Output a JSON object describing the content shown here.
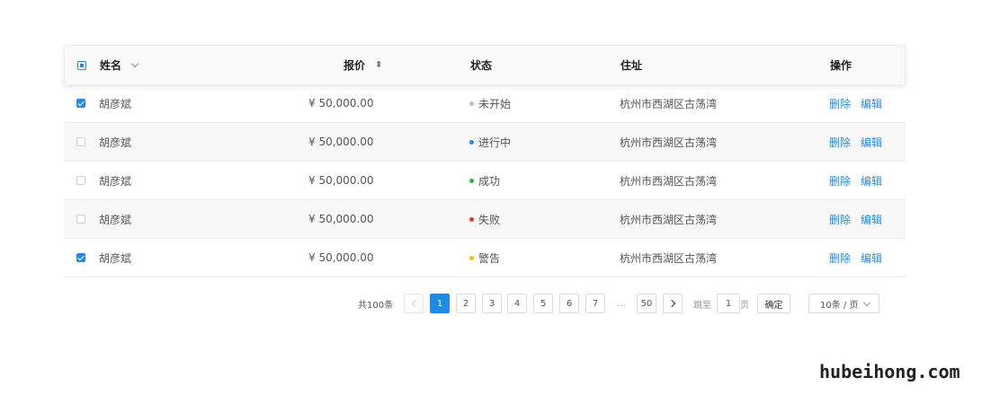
{
  "table": {
    "headers": {
      "name": "姓名",
      "price": "报价",
      "status": "状态",
      "address": "住址",
      "ops": "操作"
    },
    "rows": [
      {
        "checked": true,
        "name": "胡彦斌",
        "price": "¥ 50,000.00",
        "status": "未开始",
        "status_color": "#bfbfbf",
        "address": "杭州市西湖区古荡湾",
        "delete": "删除",
        "edit": "编辑"
      },
      {
        "checked": false,
        "name": "胡彦斌",
        "price": "¥ 50,000.00",
        "status": "进行中",
        "status_color": "#1f8ae8",
        "address": "杭州市西湖区古荡湾",
        "delete": "删除",
        "edit": "编辑"
      },
      {
        "checked": false,
        "name": "胡彦斌",
        "price": "¥ 50,000.00",
        "status": "成功",
        "status_color": "#19be3b",
        "address": "杭州市西湖区古荡湾",
        "delete": "删除",
        "edit": "编辑"
      },
      {
        "checked": false,
        "name": "胡彦斌",
        "price": "¥ 50,000.00",
        "status": "失败",
        "status_color": "#e8362b",
        "address": "杭州市西湖区古荡湾",
        "delete": "删除",
        "edit": "编辑"
      },
      {
        "checked": true,
        "name": "胡彦斌",
        "price": "¥ 50,000.00",
        "status": "警告",
        "status_color": "#f2c100",
        "address": "杭州市西湖区古荡湾",
        "delete": "删除",
        "edit": "编辑"
      }
    ]
  },
  "pagination": {
    "total": "共100条",
    "pages": [
      "1",
      "2",
      "3",
      "4",
      "5",
      "6",
      "7"
    ],
    "ellipsis": "...",
    "last": "50",
    "current": "1",
    "jump_prefix": "跳至",
    "jump_value": "1",
    "jump_suffix": "页",
    "confirm": "确定",
    "page_size": "10条 / 页"
  },
  "watermark": "hubeihong.com",
  "colors": {
    "accent": "#1f8ae8"
  }
}
